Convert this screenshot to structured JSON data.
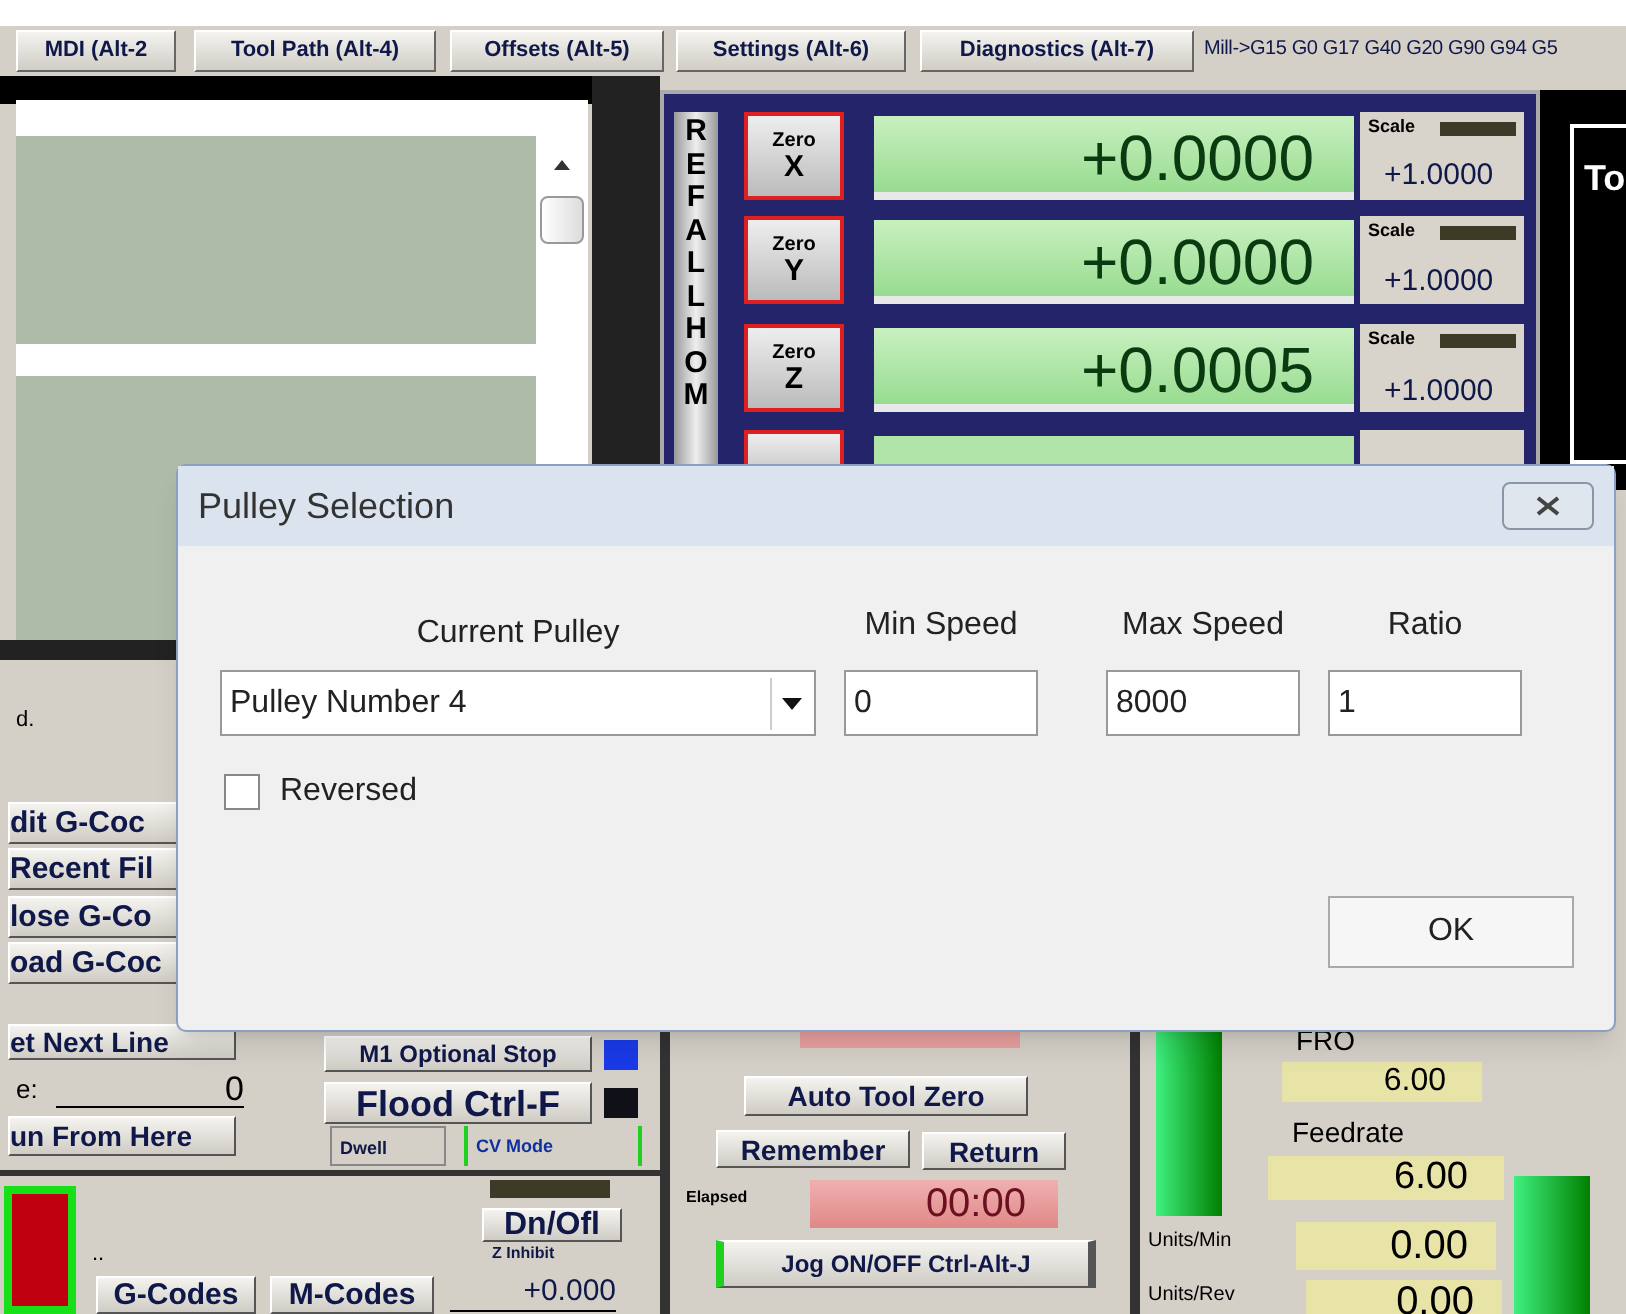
{
  "tabs": [
    {
      "label": "MDI (Alt-2",
      "selected": false
    },
    {
      "label": "Tool Path (Alt-4)",
      "selected": false
    },
    {
      "label": "Offsets (Alt-5)",
      "selected": false
    },
    {
      "label": "Settings (Alt-6)",
      "selected": false
    },
    {
      "label": "Diagnostics (Alt-7)",
      "selected": false
    }
  ],
  "modal_line": "Mill->G15  G0 G17 G40 G20 G90 G94 G5",
  "ref_all_home": "REFALLHOM",
  "axes": [
    {
      "zero_label": "Zero",
      "axis": "X",
      "value": "+0.0000",
      "scale_label": "Scale",
      "scale": "+1.0000"
    },
    {
      "zero_label": "Zero",
      "axis": "Y",
      "value": "+0.0000",
      "scale_label": "Scale",
      "scale": "+1.0000"
    },
    {
      "zero_label": "Zero",
      "axis": "Z",
      "value": "+0.0005",
      "scale_label": "Scale",
      "scale": "+1.0000"
    }
  ],
  "toolpath_text": "To",
  "status_text": "d.",
  "file_buttons": [
    "dit G-Coc",
    "Recent Fil",
    "lose G-Co",
    "oad G-Coc"
  ],
  "program": {
    "set_next_line": "et Next Line",
    "line_label": "e:",
    "line_value": "0",
    "run_from_here": "un From Here"
  },
  "toggles": [
    {
      "label": "M1 Optional Stop",
      "color": "#1a3ae8"
    },
    {
      "label": "Flood Ctrl-F",
      "color": "#101018"
    }
  ],
  "indicators": [
    {
      "label": "Dwell",
      "on": false
    },
    {
      "label": "CV Mode",
      "on": true
    }
  ],
  "lower": {
    "dots": "..",
    "z_inhibit_button": "Dn/Ofl",
    "z_inhibit_label": "Z Inhibit",
    "gcodes": "G-Codes",
    "mcodes": "M-Codes",
    "z_value": "+0.000"
  },
  "tool": {
    "auto_tool_zero": "Auto Tool Zero",
    "remember": "Remember",
    "return": "Return",
    "elapsed_label": "Elapsed",
    "elapsed": "00:00",
    "jog": "Jog ON/OFF Ctrl-Alt-J"
  },
  "feed": {
    "fro_label": "FRO",
    "fro": "6.00",
    "feedrate_label": "Feedrate",
    "feedrate": "6.00",
    "units_min_label": "Units/Min",
    "units_min": "0.00",
    "units_rev_label": "Units/Rev",
    "units_rev": "0.00"
  },
  "dialog": {
    "title": "Pulley Selection",
    "current_pulley_label": "Current Pulley",
    "current_pulley": "Pulley Number 4",
    "min_speed_label": "Min Speed",
    "min_speed": "0",
    "max_speed_label": "Max Speed",
    "max_speed": "8000",
    "ratio_label": "Ratio",
    "ratio": "1",
    "reversed_label": "Reversed",
    "reversed_checked": false,
    "ok": "OK"
  }
}
